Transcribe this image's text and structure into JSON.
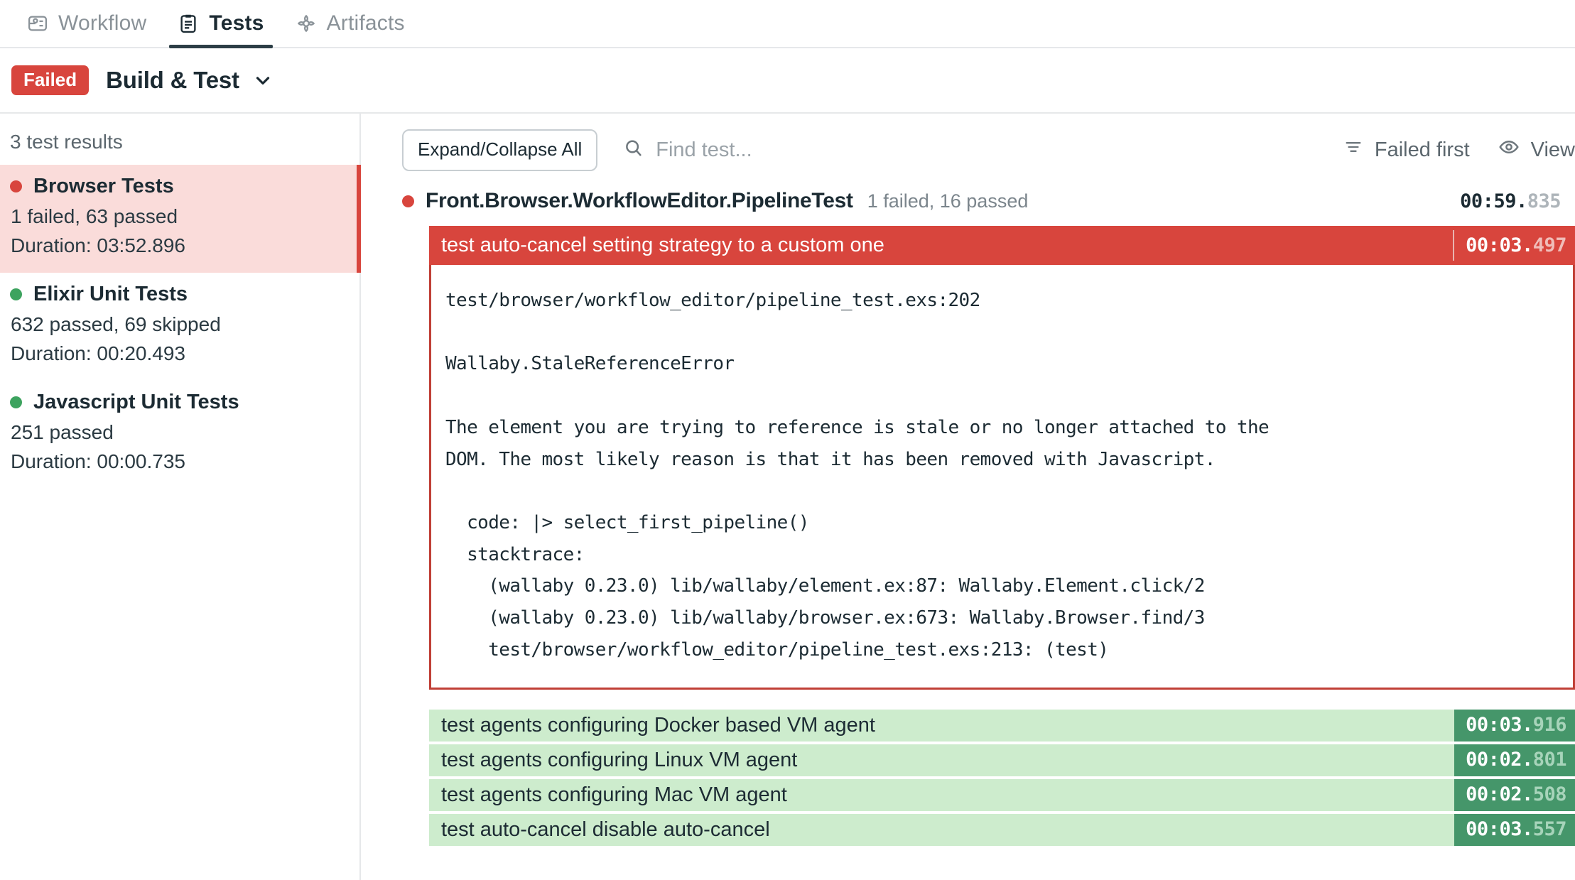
{
  "tabs": [
    {
      "label": "Workflow",
      "icon": "workflow-icon",
      "active": false
    },
    {
      "label": "Tests",
      "icon": "clipboard-icon",
      "active": true
    },
    {
      "label": "Artifacts",
      "icon": "artifacts-icon",
      "active": false
    }
  ],
  "pipeline": {
    "status_badge": "Failed",
    "name": "Build & Test",
    "chevron": "chevron-down-icon"
  },
  "sidebar": {
    "results_count": "3 test results",
    "suites": [
      {
        "name": "Browser Tests",
        "status": "failed",
        "stats": "1 failed, 63 passed",
        "duration": "Duration: 03:52.896",
        "selected": true
      },
      {
        "name": "Elixir Unit Tests",
        "status": "passed",
        "stats": "632 passed, 69 skipped",
        "duration": "Duration: 00:20.493",
        "selected": false
      },
      {
        "name": "Javascript Unit Tests",
        "status": "passed",
        "stats": "251 passed",
        "duration": "Duration: 00:00.735",
        "selected": false
      }
    ]
  },
  "toolbar": {
    "expand_collapse_label": "Expand/Collapse All",
    "search_placeholder": "Find test...",
    "search_value": "",
    "sort_label": "Failed first",
    "view_label": "View"
  },
  "suite_result": {
    "status": "failed",
    "name": "Front.Browser.WorkflowEditor.PipelineTest",
    "stats": "1 failed, 16 passed",
    "time_main": "00:59.",
    "time_ms": "835"
  },
  "failed_test": {
    "name": "test auto-cancel setting strategy to a custom one",
    "time_main": "00:03.",
    "time_ms": "497",
    "error": "test/browser/workflow_editor/pipeline_test.exs:202\n\nWallaby.StaleReferenceError\n\nThe element you are trying to reference is stale or no longer attached to the\nDOM. The most likely reason is that it has been removed with Javascript.\n\n  code: |> select_first_pipeline()\n  stacktrace:\n    (wallaby 0.23.0) lib/wallaby/element.ex:87: Wallaby.Element.click/2\n    (wallaby 0.23.0) lib/wallaby/browser.ex:673: Wallaby.Browser.find/3\n    test/browser/workflow_editor/pipeline_test.exs:213: (test)"
  },
  "passed_tests": [
    {
      "name": "test agents configuring Docker based VM agent",
      "time_main": "00:03.",
      "time_ms": "916"
    },
    {
      "name": "test agents configuring Linux VM agent",
      "time_main": "00:02.",
      "time_ms": "801"
    },
    {
      "name": "test agents configuring Mac VM agent",
      "time_main": "00:02.",
      "time_ms": "508"
    },
    {
      "name": "test auto-cancel disable auto-cancel",
      "time_main": "00:03.",
      "time_ms": "557"
    }
  ],
  "colors": {
    "fail_red": "#d8453d",
    "pass_green": "#3da35f",
    "fail_row_bg": "#fadcda",
    "pass_row_bg": "#cdeccd",
    "pass_time_bg": "#45966a",
    "accent_dark": "#2c3e46"
  }
}
